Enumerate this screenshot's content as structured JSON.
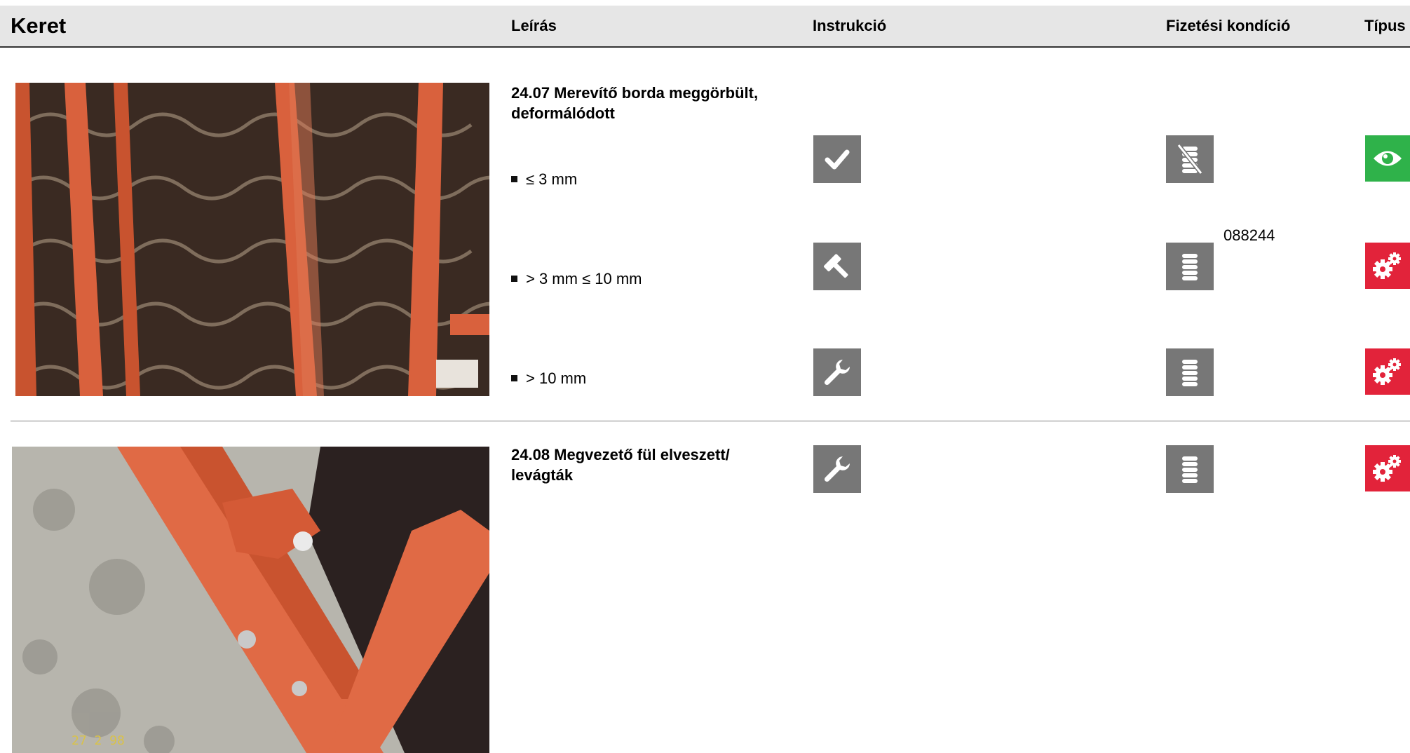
{
  "header": {
    "title": "Keret",
    "col_description": "Leírás",
    "col_instruction": "Instrukció",
    "col_payment": "Fizetési kondíció",
    "col_type": "Típus"
  },
  "items": [
    {
      "title": "24.07 Merevítő borda meggörbült, deformálódott",
      "rows": [
        {
          "label": "≤ 3 mm",
          "instruction_icon": "check-icon",
          "payment_icon": "coins-crossed-icon",
          "type_icon": "eye-icon",
          "type_color": "#2fb24a"
        },
        {
          "label": "> 3 mm ≤  10 mm",
          "instruction_icon": "hammer-icon",
          "payment_icon": "coins-icon",
          "payment_code": "088244",
          "type_icon": "gears-icon",
          "type_color": "#e2233a"
        },
        {
          "label": "> 10 mm",
          "instruction_icon": "wrench-icon",
          "payment_icon": "coins-icon",
          "type_icon": "gears-icon",
          "type_color": "#e2233a"
        }
      ]
    },
    {
      "title": "24.08 Megvezető fül elveszett/ levágták",
      "rows": [
        {
          "label": "",
          "instruction_icon": "wrench-icon",
          "payment_icon": "coins-icon",
          "type_icon": "gears-icon",
          "type_color": "#e2233a"
        }
      ]
    }
  ],
  "photo2_stamp": "27 2 98",
  "colors": {
    "header_bg": "#e6e6e6",
    "icon_grey": "#777777",
    "green": "#2fb24a",
    "red": "#e2233a"
  }
}
